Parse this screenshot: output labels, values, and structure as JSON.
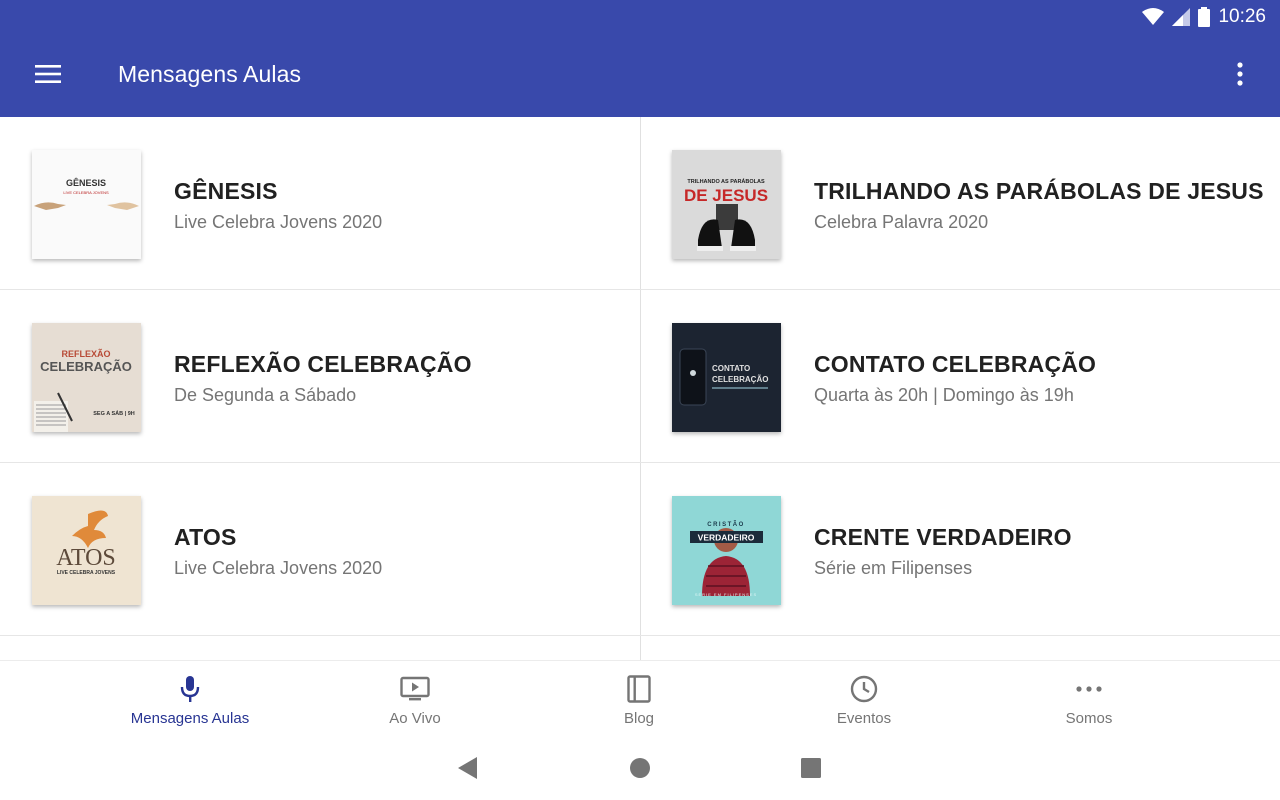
{
  "status_bar": {
    "time": "10:26"
  },
  "app_bar": {
    "title": "Mensagens Aulas",
    "color": "#3949ab"
  },
  "items": [
    {
      "title": "GÊNESIS",
      "subtitle": "Live Celebra Jovens 2020",
      "thumb_title": "GÊNESIS",
      "thumb_sub": "LIVE CELEBRA JOVENS"
    },
    {
      "title": "TRILHANDO AS PARÁBOLAS DE JESUS",
      "subtitle": "Celebra Palavra 2020",
      "thumb_title": "DE JESUS",
      "thumb_sub": "TRILHANDO AS PARÁBOLAS"
    },
    {
      "title": "REFLEXÃO CELEBRAÇÃO",
      "subtitle": "De Segunda a Sábado",
      "thumb_title": "CELEBRAÇÃO",
      "thumb_sub": "REFLEXÃO",
      "thumb_extra": "SEG A SÁB | 9H"
    },
    {
      "title": "CONTATO CELEBRAÇÃO",
      "subtitle": "Quarta às 20h | Domingo às 19h",
      "thumb_title": "CELEBRAÇÃO",
      "thumb_sub": "CONTATO"
    },
    {
      "title": "ATOS",
      "subtitle": "Live Celebra Jovens 2020",
      "thumb_title": "ATOS",
      "thumb_sub": "LIVE CELEBRA JOVENS"
    },
    {
      "title": "CRENTE VERDADEIRO",
      "subtitle": "Série em Filipenses",
      "thumb_title": "VERDADEIRO",
      "thumb_sub": "CRISTÃO",
      "thumb_extra": "SÉRIE EM FILIPENSES"
    }
  ],
  "bottom_nav": [
    {
      "label": "Mensagens Aulas",
      "icon": "microphone-icon",
      "active": true
    },
    {
      "label": "Ao Vivo",
      "icon": "live-tv-icon",
      "active": false
    },
    {
      "label": "Blog",
      "icon": "book-icon",
      "active": false
    },
    {
      "label": "Eventos",
      "icon": "clock-icon",
      "active": false
    },
    {
      "label": "Somos",
      "icon": "more-horizontal-icon",
      "active": false
    }
  ],
  "colors": {
    "primary": "#3949ab",
    "active_nav": "#283593",
    "inactive_nav": "#757575"
  }
}
